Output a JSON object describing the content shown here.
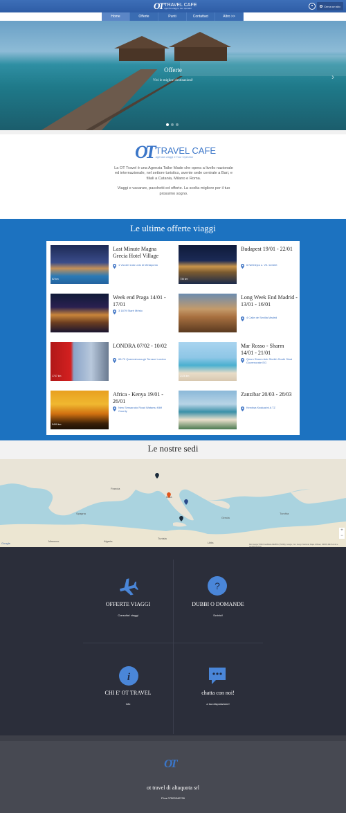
{
  "header": {
    "logo_ot": "OT",
    "logo_text": "TRAVEL CAFE",
    "logo_tagline": "agenzia viaggi e tour operator",
    "search_label": "Cerca un sito"
  },
  "nav": {
    "items": [
      "Home",
      "Offerte",
      "Punti",
      "Contattaci",
      "Altro >>"
    ]
  },
  "hero": {
    "title": "Offerte",
    "subtitle": "Vivi le migliori destinazioni!",
    "slide_count": 3,
    "active_slide": 1
  },
  "intro": {
    "brand_ot": "OT",
    "brand_name": "TRAVEL CAFE",
    "brand_tagline": "agenzia viaggi e Tour Operator",
    "paragraph1": "La OT Travel  è una Agenzia Tailor Made che opera a livello nazionale ed internazionale, nel settore turistico, avente sede centrale a Bari, e filiali a Catania, Milano e Roma.",
    "paragraph2": "Viaggi e vacanze, pacchetti ed offerte. La scelta migliore per il tuo prossimo sogno."
  },
  "offers": {
    "title": "Le ultime offerte viaggi",
    "items": [
      {
        "title": "Last Minute Magna Grecia Hotel Village",
        "address": "1 Via del Lido Lido di Metaponto",
        "size": "82 km"
      },
      {
        "title": "Budapest 19/01 - 22/01",
        "address": "6 Nefelejcs u. VII. kerület",
        "size": "736 km"
      },
      {
        "title": "Week end Praga 14/01 - 17/01",
        "address": "3 1879 Staré Město",
        "size": ""
      },
      {
        "title": "Long Week End Madrid - 13/01 - 16/01",
        "address": "4 Calle de Sevilla Madrid",
        "size": ""
      },
      {
        "title": "LONDRA 07/02 - 10/02",
        "address": "68-70 Queensborough Terrace London",
        "size": "1747 km"
      },
      {
        "title": "Mar Rosso - Sharm 14/01 - 21/01",
        "address": "Qesm Sharm Ash Sheikh South Sinai Governorate EG",
        "size": "2126 km"
      },
      {
        "title": "Africa - Kenya 19/01 - 26/01",
        "address": "New Sessarudo Road Watamu Kilifi County",
        "size": "5499 km"
      },
      {
        "title": "Zanzibar 20/03 - 28/03",
        "address": "Kendwa Kaskazini A TZ",
        "size": ""
      }
    ]
  },
  "sedi": {
    "title": "Le nostre sedi",
    "labels": [
      "Francia",
      "Italia",
      "Spagna",
      "Grecia",
      "Turchia",
      "Tunisia",
      "Marocco",
      "Algeria",
      "Libia"
    ],
    "attribution": "Dati mappa ©2016 GeoBasis-DE/BKG (©2009), Google, Inst. Geogr. Nacional, Mapa GISrael, ORION-ME   Termini e condizioni d'uso",
    "google": "Google"
  },
  "features": [
    {
      "title": "OFFERTE VIAGGI",
      "subtitle": "Consulta i viaggi",
      "icon": "plane-icon"
    },
    {
      "title": "DUBBI O DOMANDE",
      "subtitle": "Scrivici!",
      "icon": "question-icon"
    },
    {
      "title": "CHI E' OT TRAVEL",
      "subtitle": "Info",
      "icon": "info-icon"
    },
    {
      "title": "chatta con noi!",
      "subtitle": "a tua disposizione!",
      "icon": "chat-icon"
    }
  ],
  "footer": {
    "logo": "OT",
    "company": "ot travel di altaquota srl",
    "piva": "P.iva 07503340726"
  },
  "colors": {
    "header_blue": "#3d6fb8",
    "offers_blue": "#1c72c0",
    "features_bg": "#2b2e3a",
    "footer_bg": "#474952",
    "brand_blue": "#3b76c8"
  }
}
